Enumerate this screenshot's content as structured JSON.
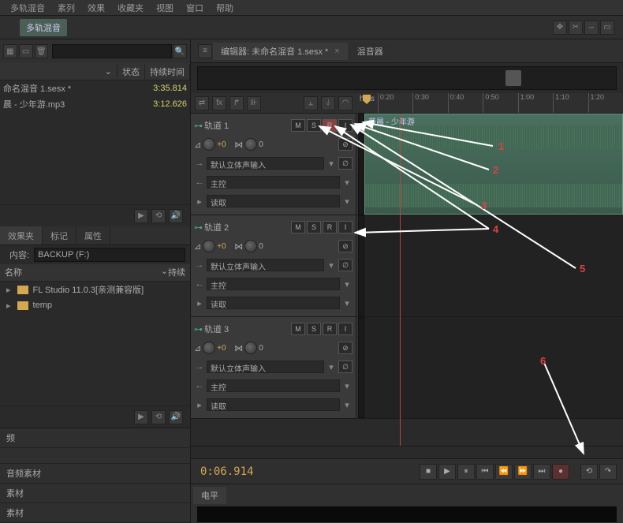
{
  "menus": {
    "m1": "多轨混音",
    "m2": "素列",
    "m3": "效果",
    "m4": "收藏夹",
    "m5": "视图",
    "m6": "窗口",
    "m7": "帮助"
  },
  "toolbar_tab": "多轨混音",
  "left": {
    "hdr_status": "状态",
    "hdr_dur": "持续时间",
    "files": [
      {
        "name": "命名混音 1.sesx *",
        "dur": "3:35.814"
      },
      {
        "name": "晨 - 少年游.mp3",
        "dur": "3:12.626"
      }
    ],
    "tabs": {
      "t1": "效果夹",
      "t2": "标记",
      "t3": "属性"
    },
    "content_label": "内容:",
    "backup": "BACKUP (F:)",
    "name_hdr": "名称",
    "hold_hdr": "持续",
    "tree": [
      {
        "name": "FL Studio 11.0.3[亲测兼容版]"
      },
      {
        "name": "temp"
      }
    ],
    "bot": {
      "b1": "频",
      "b2": "音频素材",
      "b3": "素材",
      "b4": "素材"
    }
  },
  "editor": {
    "tab1": "编辑器: 未命名混音 1.sesx *",
    "tab2": "混音器"
  },
  "ruler": {
    "hms": "hms",
    "ticks": [
      "0:20",
      "0:30",
      "0:40",
      "0:50",
      "1:00",
      "1:10",
      "1:20"
    ]
  },
  "tracks": [
    {
      "name": "轨道 1",
      "vol": "+0",
      "pan": "0",
      "input": "默认立体声输入",
      "output": "主控",
      "read": "读取",
      "clip": "薇晨 - 少年游"
    },
    {
      "name": "轨道 2",
      "vol": "+0",
      "pan": "0",
      "input": "默认立体声输入",
      "output": "主控",
      "read": "读取"
    },
    {
      "name": "轨道 3",
      "vol": "+0",
      "pan": "0",
      "input": "默认立体声输入",
      "output": "主控",
      "read": "读取"
    }
  ],
  "timecode": "0:06.914",
  "level_label": "电平",
  "annotations": [
    "1",
    "2",
    "3",
    "4",
    "5",
    "6"
  ]
}
